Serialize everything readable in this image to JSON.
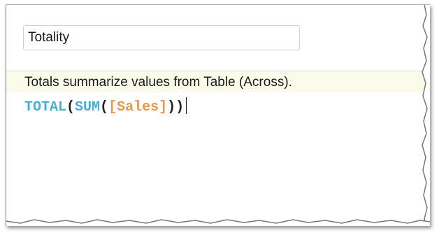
{
  "calc_name": {
    "value": "Totality"
  },
  "info": {
    "text": "Totals summarize values from Table (Across)."
  },
  "formula": {
    "tokens": [
      {
        "text": "TOTAL",
        "kind": "function"
      },
      {
        "text": "(",
        "kind": "paren"
      },
      {
        "text": "SUM",
        "kind": "function"
      },
      {
        "text": "(",
        "kind": "paren"
      },
      {
        "text": "[Sales]",
        "kind": "field"
      },
      {
        "text": ")",
        "kind": "paren"
      },
      {
        "text": ")",
        "kind": "paren"
      }
    ]
  },
  "colors": {
    "function": "#4aaed2",
    "field": "#e8974b",
    "info_background": "#fbfbea"
  }
}
